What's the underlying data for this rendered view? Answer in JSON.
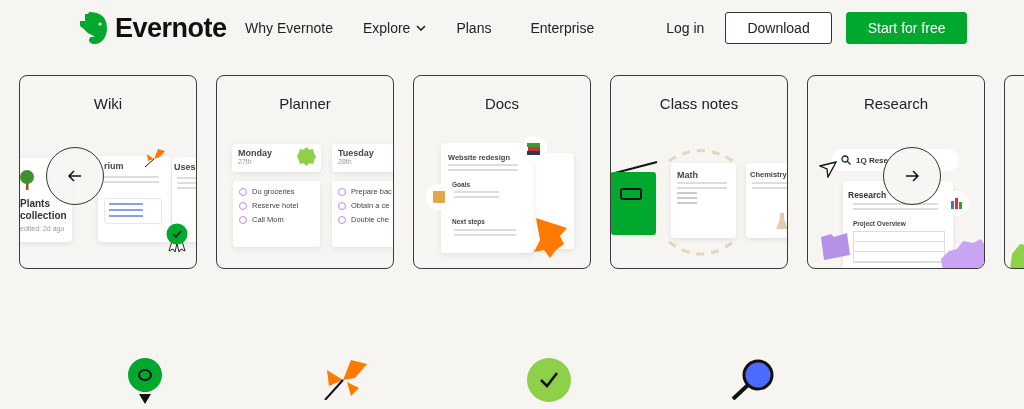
{
  "header": {
    "brand": "Evernote",
    "nav": [
      {
        "label": "Why Evernote",
        "dropdown": false
      },
      {
        "label": "Explore",
        "dropdown": true
      },
      {
        "label": "Plans",
        "dropdown": false
      },
      {
        "label": "Enterprise",
        "dropdown": false
      }
    ],
    "login": "Log in",
    "download": "Download",
    "cta": "Start for free"
  },
  "carousel": {
    "cards": [
      {
        "kind": "wiki",
        "title": "Wiki",
        "texts": [
          "Plants collection",
          "edited: 2d ago",
          "rium",
          "Uses"
        ]
      },
      {
        "kind": "planner",
        "title": "Planner",
        "days": [
          {
            "day": "Monday",
            "date": "27th",
            "tasks": [
              {
                "text": "Do groceries",
                "checked": false
              },
              {
                "text": "Reserve hotel",
                "checked": false
              },
              {
                "text": "Call Mom",
                "checked": false
              }
            ]
          },
          {
            "day": "Tuesday",
            "date": "28th",
            "tasks": [
              {
                "text": "Prepare bac",
                "checked": false
              },
              {
                "text": "Obtain a ce",
                "checked": false
              },
              {
                "text": "Double che",
                "checked": false
              }
            ]
          }
        ]
      },
      {
        "kind": "docs",
        "title": "Docs",
        "texts": [
          "Website redesign",
          "Goals",
          "Next steps"
        ]
      },
      {
        "kind": "classnotes",
        "title": "Class notes",
        "texts": [
          "Math",
          "Chemistry"
        ]
      },
      {
        "kind": "research",
        "title": "Research",
        "texts": [
          "1Q Rese",
          "Research",
          "Project Overview"
        ]
      }
    ]
  }
}
